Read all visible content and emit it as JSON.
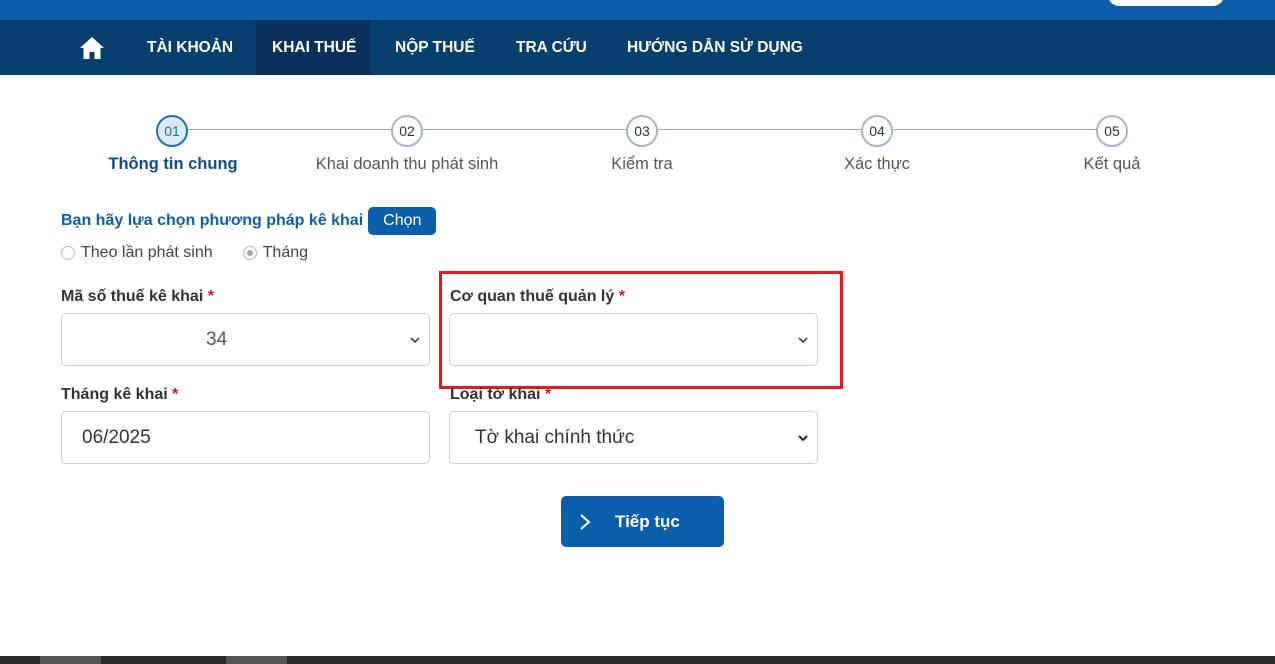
{
  "nav": {
    "home_icon": "home-icon",
    "items": [
      {
        "label": "TÀI KHOẢN"
      },
      {
        "label": "KHAI THUẾ"
      },
      {
        "label": "NỘP THUẾ"
      },
      {
        "label": "TRA CỨU"
      },
      {
        "label": "HƯỚNG DẪN SỬ DỤNG"
      }
    ],
    "active": "KHAI THUẾ"
  },
  "steps": [
    {
      "num": "01",
      "label": "Thông tin chung"
    },
    {
      "num": "02",
      "label": "Khai doanh thu phát sinh"
    },
    {
      "num": "03",
      "label": "Kiểm tra"
    },
    {
      "num": "04",
      "label": "Xác thực"
    },
    {
      "num": "05",
      "label": "Kết quả"
    }
  ],
  "method": {
    "prompt": "Bạn hãy lựa chọn phương pháp kê khai",
    "button": "Chọn",
    "options": [
      "Theo lần phát sinh",
      "Tháng"
    ],
    "selected": "Tháng"
  },
  "form": {
    "tax_code": {
      "label": "Mã số thuế kê khai",
      "required": "*",
      "value": "34"
    },
    "tax_office": {
      "label": "Cơ quan thuế quản lý",
      "required": "*",
      "value": ""
    },
    "period": {
      "label": "Tháng kê khai",
      "required": "*",
      "value": "06/2025"
    },
    "form_type": {
      "label": "Loại tờ khai",
      "required": "*",
      "value": "Tờ khai chính thức"
    }
  },
  "continue_button": {
    "label": "Tiếp tục"
  },
  "colors": {
    "nav_bg": "#063e6e",
    "primary": "#0b5ea8",
    "highlight": "#e01b24",
    "required": "#d0151f"
  }
}
